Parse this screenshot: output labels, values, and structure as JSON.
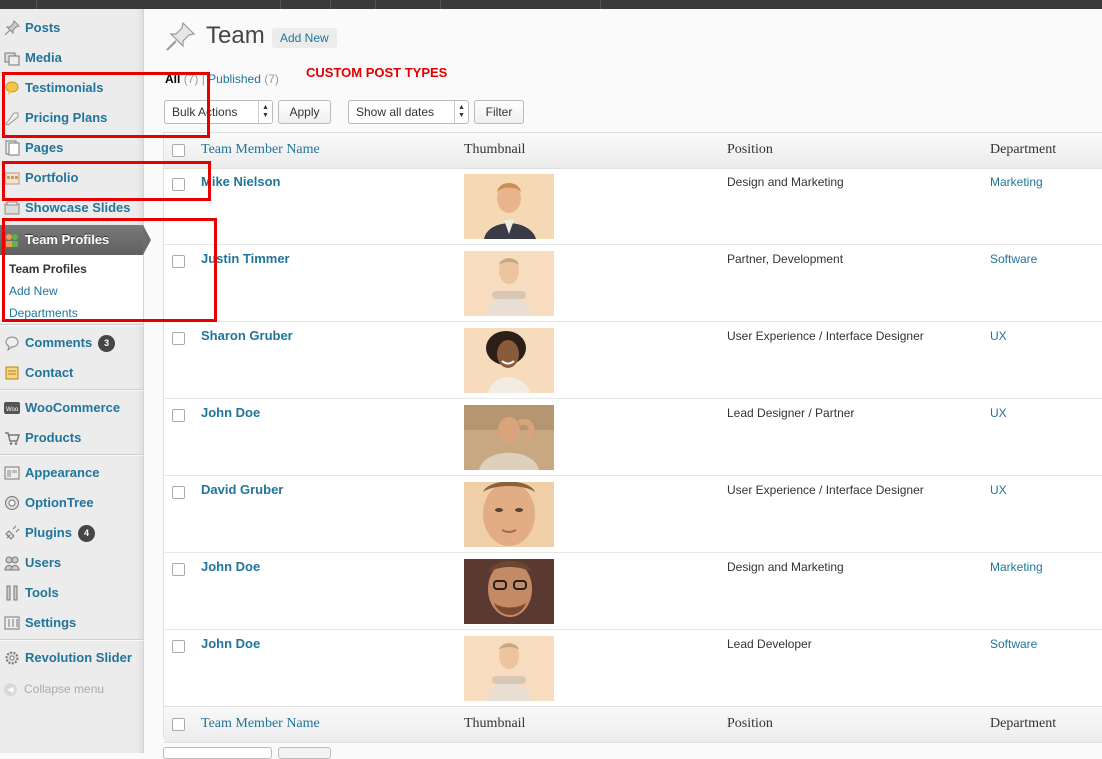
{
  "sidebar": {
    "items": [
      {
        "label": "Posts",
        "icon": "pushpin-icon"
      },
      {
        "label": "Media",
        "icon": "media-icon"
      },
      {
        "label": "Testimonials",
        "icon": "speech-bubble-icon"
      },
      {
        "label": "Pricing Plans",
        "icon": "tag-icon"
      },
      {
        "label": "Pages",
        "icon": "pages-icon"
      },
      {
        "label": "Portfolio",
        "icon": "portfolio-icon"
      },
      {
        "label": "Showcase Slides",
        "icon": "slides-icon"
      },
      {
        "label": "Team Profiles",
        "icon": "team-icon"
      },
      {
        "label": "Comments",
        "icon": "comment-icon",
        "badge": "3"
      },
      {
        "label": "Contact",
        "icon": "contact-icon"
      },
      {
        "label": "WooCommerce",
        "icon": "woo-icon"
      },
      {
        "label": "Products",
        "icon": "cart-icon"
      },
      {
        "label": "Appearance",
        "icon": "appearance-icon"
      },
      {
        "label": "OptionTree",
        "icon": "optiontree-icon"
      },
      {
        "label": "Plugins",
        "icon": "plug-icon",
        "badge": "4"
      },
      {
        "label": "Users",
        "icon": "users-icon"
      },
      {
        "label": "Tools",
        "icon": "tools-icon"
      },
      {
        "label": "Settings",
        "icon": "settings-icon"
      },
      {
        "label": "Revolution Slider",
        "icon": "gear-icon"
      }
    ],
    "submenu": [
      "Team Profiles",
      "Add New",
      "Departments"
    ],
    "collapse": "Collapse menu"
  },
  "header": {
    "title": "Team",
    "add_new": "Add New"
  },
  "filters": {
    "all_label": "All",
    "all_count": "(7)",
    "separator": "|",
    "published_label": "Published",
    "published_count": "(7)",
    "bulk_actions": "Bulk Actions",
    "apply": "Apply",
    "dates": "Show all dates",
    "filter": "Filter"
  },
  "annotation": "CUSTOM POST TYPES",
  "table": {
    "columns": [
      "Team Member Name",
      "Thumbnail",
      "Position",
      "Department"
    ],
    "rows": [
      {
        "name": "Mike Nielson",
        "position": "Design and Marketing",
        "department": "Marketing"
      },
      {
        "name": "Justin Timmer",
        "position": "Partner, Development",
        "department": "Software"
      },
      {
        "name": "Sharon Gruber",
        "position": "User Experience / Interface Designer",
        "department": "UX"
      },
      {
        "name": "John Doe",
        "position": "Lead Designer / Partner",
        "department": "UX"
      },
      {
        "name": "David Gruber",
        "position": "User Experience / Interface Designer",
        "department": "UX"
      },
      {
        "name": "John Doe",
        "position": "Design and Marketing",
        "department": "Marketing"
      },
      {
        "name": "John Doe",
        "position": "Lead Developer",
        "department": "Software"
      }
    ]
  },
  "colors": {
    "link": "#21759b",
    "annotation_red": "#e60000",
    "sidebar_bg": "#ececec"
  }
}
